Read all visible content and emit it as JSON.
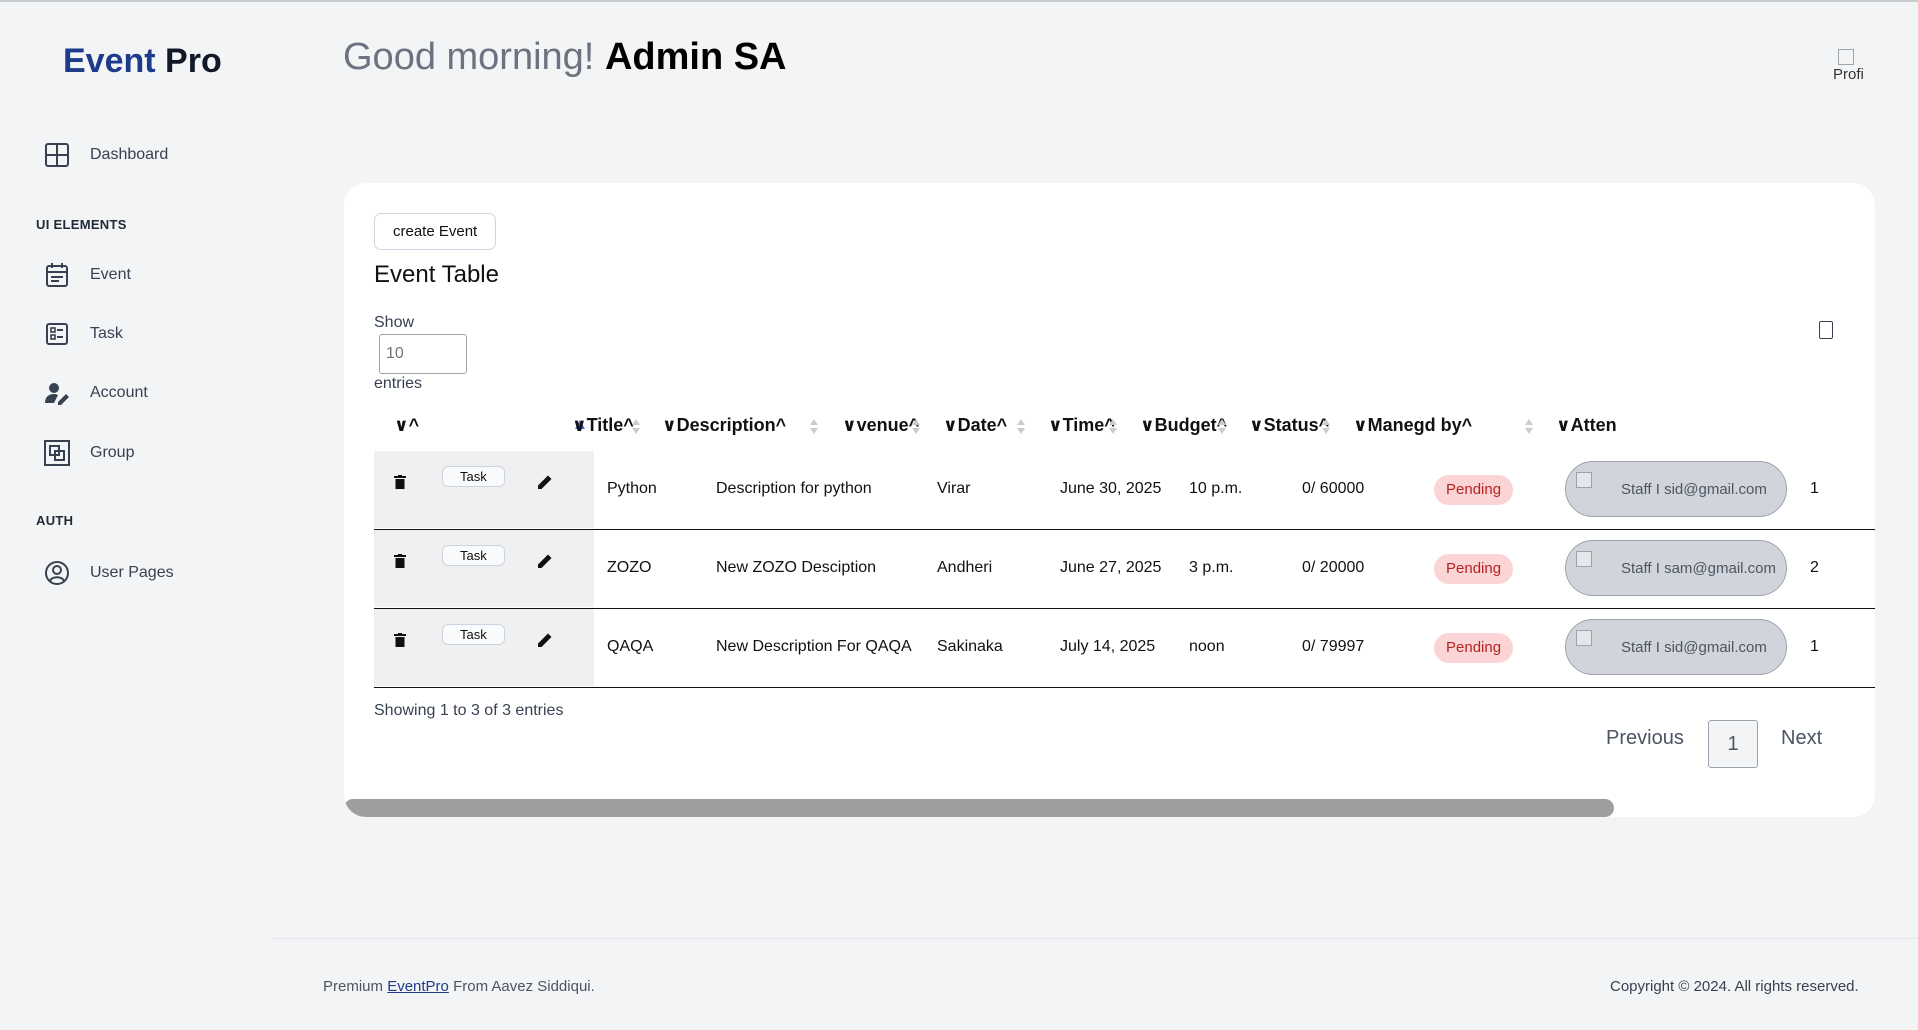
{
  "brand": {
    "part1": "Event",
    "part2": "Pro"
  },
  "sidebar": {
    "dashboard": {
      "label": "Dashboard",
      "icon": "grid-icon"
    },
    "section_ui": "UI ELEMENTS",
    "items": [
      {
        "label": "Event",
        "icon": "calendar-icon"
      },
      {
        "label": "Task",
        "icon": "checklist-icon"
      },
      {
        "label": "Account",
        "icon": "user-edit-icon"
      },
      {
        "label": "Group",
        "icon": "group-icon"
      }
    ],
    "section_auth": "AUTH",
    "auth_items": [
      {
        "label": "User Pages",
        "icon": "user-circle-icon"
      }
    ]
  },
  "header": {
    "greeting": "Good morning!",
    "user_name": "Admin SA",
    "profile_alt": "Profi"
  },
  "card": {
    "create_button": "create Event",
    "title": "Event Table",
    "show_label": "Show",
    "show_placeholder": "10",
    "entries_label": "entries"
  },
  "table": {
    "first_header": "∨^",
    "columns": [
      "∨Title^",
      "∨Description^",
      "∨venue^",
      "∨Date^",
      "∨Time^",
      "∨Budget^",
      "∨Status^",
      "∨Manegd by^",
      "∨Atten"
    ],
    "task_label": "Task",
    "rows": [
      {
        "title": "Python",
        "description": "Description for python",
        "venue": "Virar",
        "date": "June 30, 2025",
        "time": "10 p.m.",
        "budget": "0/ 60000",
        "status": "Pending",
        "managed_by": "Staff I sid@gmail.com",
        "attendees": "1"
      },
      {
        "title": "ZOZO",
        "description": "New ZOZO Desciption",
        "venue": "Andheri",
        "date": "June 27, 2025",
        "time": "3 p.m.",
        "budget": "0/ 20000",
        "status": "Pending",
        "managed_by": "Staff I sam@gmail.com",
        "attendees": "2"
      },
      {
        "title": "QAQA",
        "description": "New Description For QAQA",
        "venue": "Sakinaka",
        "date": "July 14, 2025",
        "time": "noon",
        "budget": "0/ 79997",
        "status": "Pending",
        "managed_by": "Staff I sid@gmail.com",
        "attendees": "1"
      }
    ]
  },
  "pagination": {
    "info": "Showing 1 to 3 of 3 entries",
    "previous": "Previous",
    "current_page": "1",
    "next": "Next"
  },
  "footer": {
    "prefix": "Premium",
    "link": "EventPro",
    "suffix": "From Aavez Siddiqui.",
    "copyright": "Copyright © 2024. All rights reserved."
  },
  "colors": {
    "brand_blue": "#1e3a8a",
    "badge_bg": "#fbd5d5",
    "badge_text": "#b42323",
    "sort_active": "#4f6bd8"
  }
}
